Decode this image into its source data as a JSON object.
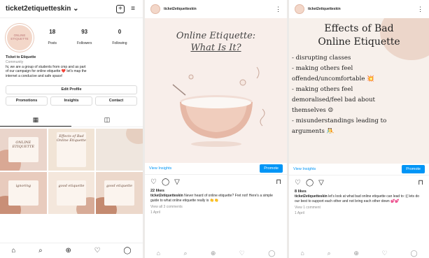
{
  "profile": {
    "username": "ticket2etiquetteskin",
    "username_chevron": "⌄",
    "add_icon": "+",
    "menu_icon": "≡",
    "avatar_text": "ONLINE ETIQUETTE",
    "posts_count": "18",
    "posts_label": "Posts",
    "followers_count": "93",
    "followers_label": "Followers",
    "following_count": "0",
    "following_label": "Following",
    "bio_name": "Ticket to Etiquette",
    "bio_category": "Community",
    "bio_line1": "hi, we are a group of students from cmp and as part",
    "bio_line2": "of our campaign for online etiquette ❤️ let's map the",
    "bio_line3": "internet a conducive and safe space!",
    "edit_profile": "Edit Profile",
    "buttons": [
      "Promotions",
      "Insights",
      "Contact"
    ],
    "grid_tab_icon": "▦",
    "tagged_tab_icon": "◫"
  },
  "grid": [
    {
      "text": "ONLINE ETIQUETTE"
    },
    {
      "text": "Effects of Bad Online Etiquette"
    },
    {
      "text": ""
    },
    {
      "text": "ignoring"
    },
    {
      "text": "good etiquette"
    },
    {
      "text": "good etiquette"
    }
  ],
  "post1": {
    "username": "ticket2etiquetteskin",
    "image_title_line1": "Online Etiquette:",
    "image_title_line2": "What Is It?",
    "view_insights": "View Insights",
    "promote": "Promote",
    "likes": "22 likes",
    "caption_user": "ticket2etiquetteskin",
    "caption": "Never heard of online etiquette? Fret not! Here's a simple guide to what online etiquette really is 👏👏",
    "comments": "View all 3 comments",
    "time": "1 April"
  },
  "post2": {
    "username": "ticket2etiquetteskin",
    "image_title_line1": "Effects of Bad",
    "image_title_line2": "Online Etiquette",
    "bullets": [
      "- disrupting classes",
      "- making others feel",
      "offended/uncomfortable 💥",
      "- making others feel",
      "demoralised/feel bad about",
      "themselves ☹",
      "- misunderstandings leading to",
      "arguments 🤼"
    ],
    "view_insights": "View Insights",
    "promote": "Promote",
    "likes": "8 likes",
    "caption_user": "ticket2etiquetteskin",
    "caption": "let's look at what bad online etiquette can lead to :(( lets do our best to support each other and not bring each other down 💕💕",
    "comments": "View 1 comment",
    "time": "1 April"
  },
  "nav_icons": [
    "⌂",
    "⌕",
    "⊕",
    "♡",
    "◯"
  ],
  "colors": {
    "accent": "#0095f6",
    "peach": "#f3d7c9",
    "blush": "#e8cbbd"
  }
}
